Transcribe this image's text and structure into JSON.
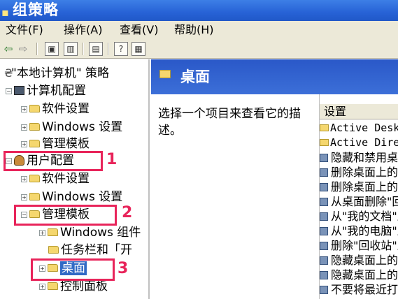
{
  "window": {
    "title": "组策略"
  },
  "menu": [
    "文件(F)",
    "操作(A)",
    "查看(V)",
    "帮助(H)"
  ],
  "tree": {
    "root": "\"本地计算机\" 策略",
    "computer_config": "计算机配置",
    "cc_software": "软件设置",
    "cc_windows": "Windows 设置",
    "cc_admin": "管理模板",
    "user_config": "用户配置",
    "uc_software": "软件设置",
    "uc_windows": "Windows 设置",
    "uc_admin": "管理模板",
    "uc_admin_windows": "Windows 组件",
    "uc_admin_taskbar": "任务栏和「开",
    "uc_admin_desktop": "桌面",
    "uc_admin_control": "控制面板"
  },
  "annotations": [
    "1",
    "2",
    "3"
  ],
  "right_pane": {
    "header": "桌面",
    "description": "选择一个项目来查看它的描述。",
    "column_header": "设置",
    "rows": [
      {
        "type": "folder",
        "text": "Active Desktop"
      },
      {
        "type": "folder",
        "text": "Active Directory"
      },
      {
        "type": "policy",
        "text": "隐藏和禁用桌面上的所有项目"
      },
      {
        "type": "policy",
        "text": "删除桌面上的\"我的文档\"图标"
      },
      {
        "type": "policy",
        "text": "删除桌面上的\"我的电脑\"图标"
      },
      {
        "type": "policy",
        "text": "从桌面删除\"回收站\"图标"
      },
      {
        "type": "policy",
        "text": "从\"我的文档\"上下文菜单删除\"属性\""
      },
      {
        "type": "policy",
        "text": "从\"我的电脑\"上下文菜单删除\"属性\""
      },
      {
        "type": "policy",
        "text": "删除\"回收站\"上下文菜单中的\"属性\""
      },
      {
        "type": "policy",
        "text": "隐藏桌面上的\"网上邻居\"图标"
      },
      {
        "type": "policy",
        "text": "隐藏桌面上的\"Internet Explorer\"图标"
      },
      {
        "type": "policy",
        "text": "不要将最近打开的文档的共享添加到网上邻居"
      }
    ]
  }
}
